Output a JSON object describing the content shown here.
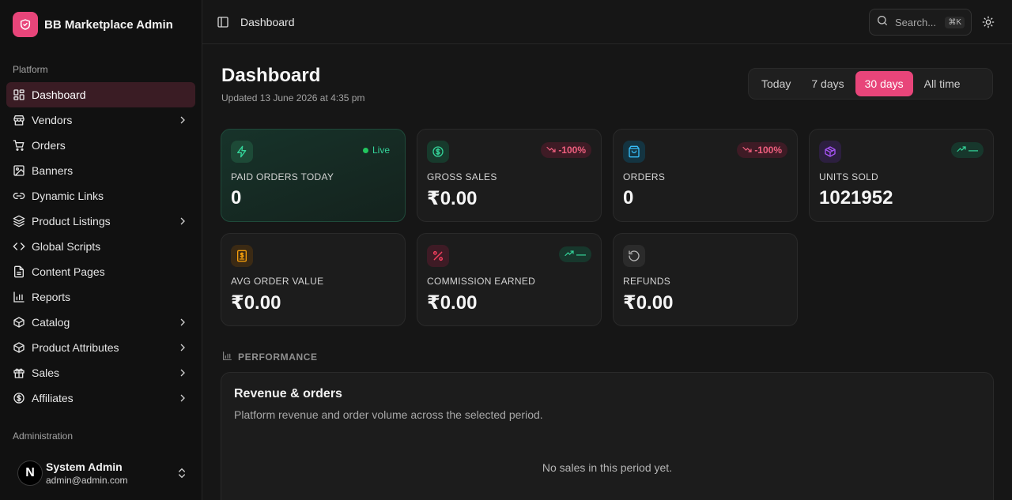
{
  "app": {
    "name": "BB Marketplace Admin"
  },
  "sidebar": {
    "platform_label": "Platform",
    "admin_label": "Administration",
    "items": [
      {
        "label": "Dashboard",
        "icon": "grid-icon",
        "active": true,
        "chevron": false
      },
      {
        "label": "Vendors",
        "icon": "store-icon",
        "chevron": true
      },
      {
        "label": "Orders",
        "icon": "cart-icon",
        "chevron": false
      },
      {
        "label": "Banners",
        "icon": "image-icon",
        "chevron": false
      },
      {
        "label": "Dynamic Links",
        "icon": "link-icon",
        "chevron": false
      },
      {
        "label": "Product Listings",
        "icon": "layers-icon",
        "chevron": true
      },
      {
        "label": "Global Scripts",
        "icon": "code-icon",
        "chevron": false
      },
      {
        "label": "Content Pages",
        "icon": "file-icon",
        "chevron": false
      },
      {
        "label": "Reports",
        "icon": "bar-chart-icon",
        "chevron": false
      },
      {
        "label": "Catalog",
        "icon": "box-icon",
        "chevron": true
      },
      {
        "label": "Product Attributes",
        "icon": "box-icon",
        "chevron": true
      },
      {
        "label": "Sales",
        "icon": "gift-icon",
        "chevron": true
      },
      {
        "label": "Affiliates",
        "icon": "dollar-icon",
        "chevron": true
      }
    ],
    "user": {
      "avatar_letter": "N",
      "name": "System Admin",
      "email": "admin@admin.com"
    }
  },
  "header": {
    "breadcrumb": "Dashboard",
    "search_placeholder": "Search...",
    "search_shortcut": "⌘K"
  },
  "main": {
    "title": "Dashboard",
    "updated": "Updated 13 June 2026 at 4:35 pm",
    "ranges": [
      "Today",
      "7 days",
      "30 days",
      "All time"
    ],
    "active_range": "30 days",
    "cards": [
      {
        "label": "PAID ORDERS TODAY",
        "value": "0",
        "badge": "Live",
        "badge_type": "live",
        "icon": "bolt-icon",
        "accent": "#22c55e"
      },
      {
        "label": "GROSS SALES",
        "value": "₹0.00",
        "badge": "-100%",
        "badge_type": "neg",
        "icon": "dollar-circle-icon",
        "accent": "#22c55e"
      },
      {
        "label": "ORDERS",
        "value": "0",
        "badge": "-100%",
        "badge_type": "neg",
        "icon": "shopping-bag-icon",
        "accent": "#38bdf8"
      },
      {
        "label": "UNITS SOLD",
        "value": "1021952",
        "badge": "—",
        "badge_type": "pos",
        "icon": "package-icon",
        "accent": "#a855f7"
      },
      {
        "label": "AVG ORDER VALUE",
        "value": "₹0.00",
        "badge": "",
        "badge_type": "none",
        "icon": "receipt-icon",
        "accent": "#f59e0b"
      },
      {
        "label": "COMMISSION EARNED",
        "value": "₹0.00",
        "badge": "—",
        "badge_type": "pos",
        "icon": "percent-icon",
        "accent": "#f43f5e"
      },
      {
        "label": "REFUNDS",
        "value": "₹0.00",
        "badge": "",
        "badge_type": "none",
        "icon": "refresh-icon",
        "accent": "#a3a3a3"
      }
    ],
    "performance_label": "PERFORMANCE",
    "panel": {
      "title": "Revenue & orders",
      "subtitle": "Platform revenue and order volume across the selected period.",
      "empty": "No sales in this period yet."
    }
  }
}
